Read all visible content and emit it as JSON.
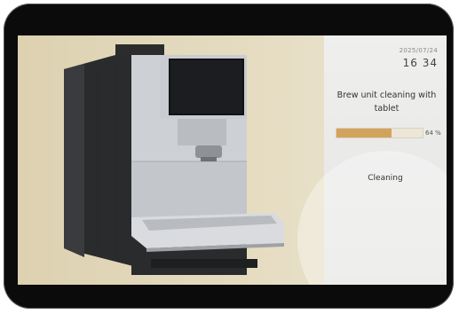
{
  "status_panel": {
    "date": "2025/07/24",
    "time": "16 34",
    "task_title": "Brew unit cleaning with tablet",
    "progress_percent": 64,
    "progress_label": "64 %",
    "status_text": "Cleaning"
  },
  "colors": {
    "progress_fill": "#d2a35c",
    "screen_background": "#e5dcc1",
    "panel_background": "#e8e8e6"
  },
  "icons": {
    "machine_image": "coffee-machine-illustration"
  }
}
